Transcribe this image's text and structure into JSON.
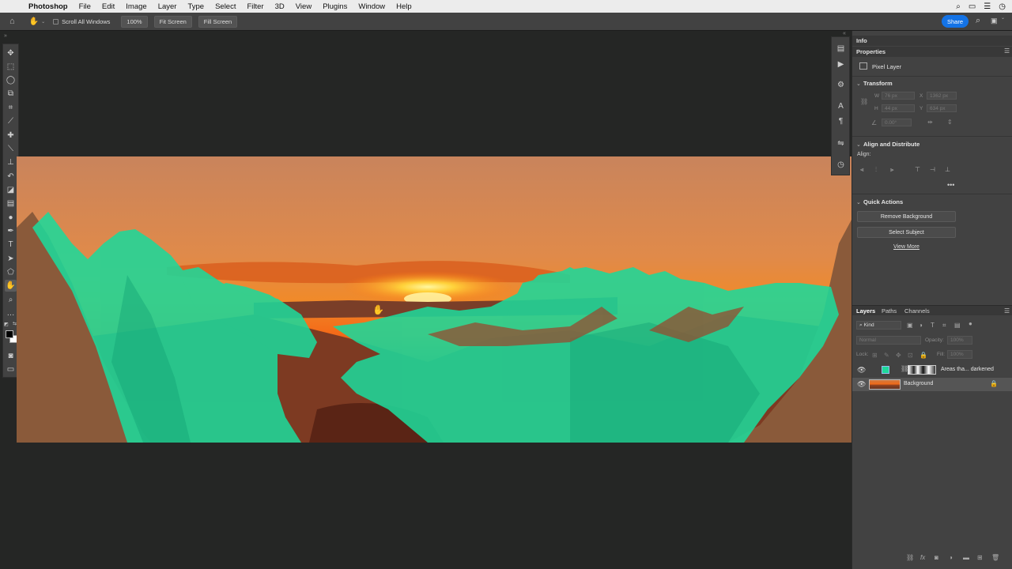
{
  "menubar": {
    "app": "Photoshop",
    "items": [
      "File",
      "Edit",
      "Image",
      "Layer",
      "Type",
      "Select",
      "Filter",
      "3D",
      "View",
      "Plugins",
      "Window",
      "Help"
    ]
  },
  "options": {
    "scroll_all": "Scroll All Windows",
    "zoom": "100%",
    "fit": "Fit Screen",
    "fill": "Fill Screen",
    "share": "Share"
  },
  "panel": {
    "info_tab": "Info",
    "properties_tab": "Properties",
    "layer_kind": "Pixel Layer",
    "transform": {
      "title": "Transform",
      "w_label": "W",
      "w": "76 px",
      "x_label": "X",
      "x": "1362 px",
      "h_label": "H",
      "h": "44 px",
      "y_label": "Y",
      "y": "634 px",
      "angle": "0.00°"
    },
    "align": {
      "title": "Align and Distribute",
      "label": "Align:"
    },
    "quick": {
      "title": "Quick Actions",
      "remove_bg": "Remove Background",
      "select_subject": "Select Subject",
      "view_more": "View More"
    }
  },
  "layers": {
    "tabs": [
      "Layers",
      "Paths",
      "Channels"
    ],
    "kind": "Kind",
    "blend": "Normal",
    "opacity_label": "Opacity:",
    "opacity": "100%",
    "lock_label": "Lock:",
    "fill_label": "Fill:",
    "fill": "100%",
    "items": [
      {
        "name": "Areas tha... darkened"
      },
      {
        "name": "Background"
      }
    ]
  },
  "colors": {
    "overlay": "#1ed89a",
    "accent": "#1473e6",
    "ui_bg": "#424242",
    "canvas_bg": "#252625"
  }
}
